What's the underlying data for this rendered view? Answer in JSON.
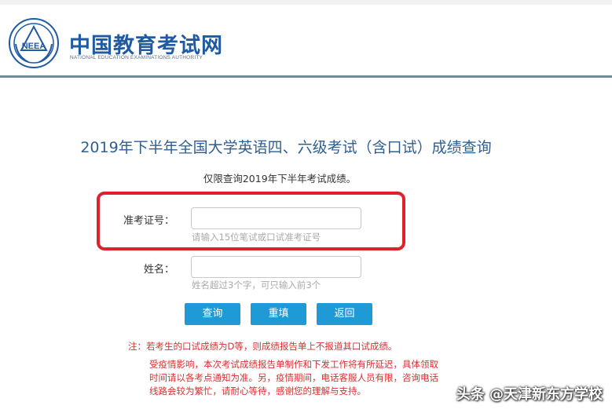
{
  "header": {
    "logo_cn": "中国教育考试网",
    "logo_en": "NATIONAL EDUCATION EXAMINATIONS AUTHORITY",
    "seal_text": "NEEA"
  },
  "page": {
    "title": "2019年下半年全国大学英语四、六级考试（含口试）成绩查询",
    "subtitle": "仅限查询2019年下半年考试成绩。"
  },
  "form": {
    "ticket": {
      "label": "准考证号：",
      "value": "",
      "hint": "请输入15位笔试或口试准考证号"
    },
    "name": {
      "label": "姓名：",
      "value": "",
      "hint": "姓名超过3个字，可只输入前3个"
    }
  },
  "buttons": {
    "query": "查询",
    "reset": "重填",
    "back": "返回"
  },
  "notes": {
    "line1": "注：若考生的口试成绩为D等，则成绩报告单上不报道其口试成绩。",
    "line2": "受疫情影响，本次考试成绩报告单制作和下发工作将有所延迟，具体领取",
    "line3": "时间请以各考点通知为准。另，疫情期间，电话客服人员有限，咨询电话",
    "line4": "线路会较为繁忙，请耐心等待，感谢您的理解与支持。"
  },
  "watermark": "头条 @天津新东方学校",
  "colors": {
    "brand": "#1f5aa2",
    "button": "#1e9bd7",
    "highlight": "#e0202a",
    "note": "#d73030"
  }
}
